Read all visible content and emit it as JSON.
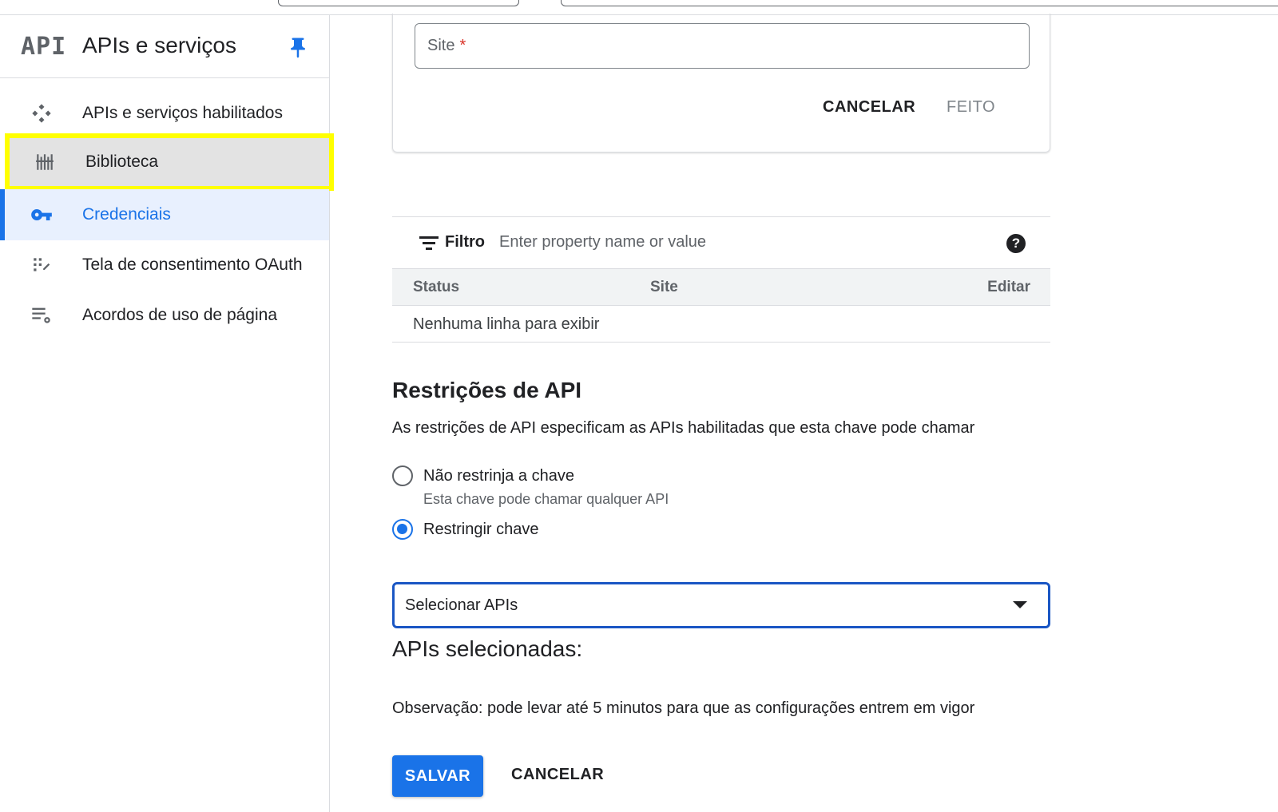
{
  "sidebar": {
    "logo_text": "API",
    "title": "APIs e serviços",
    "items": [
      {
        "label": "APIs e serviços habilitados",
        "icon": "dashboard-icon"
      },
      {
        "label": "Biblioteca",
        "icon": "library-icon"
      },
      {
        "label": "Credenciais",
        "icon": "key-icon"
      },
      {
        "label": "Tela de consentimento OAuth",
        "icon": "consent-icon"
      },
      {
        "label": "Acordos de uso de página",
        "icon": "settings-list-icon"
      }
    ]
  },
  "site_card": {
    "input_placeholder": "Site",
    "required_mark": "*",
    "cancel_label": "CANCELAR",
    "done_label": "FEITO"
  },
  "filter": {
    "label": "Filtro",
    "placeholder": "Enter property name or value",
    "help": "?"
  },
  "table": {
    "columns": [
      "Status",
      "Site",
      "Editar"
    ],
    "empty_text": "Nenhuma linha para exibir"
  },
  "api_restrictions": {
    "title": "Restrições de API",
    "description": "As restrições de API especificam as APIs habilitadas que esta chave pode chamar",
    "options": [
      {
        "label": "Não restrinja a chave",
        "sublabel": "Esta chave pode chamar qualquer API",
        "checked": false
      },
      {
        "label": "Restringir chave",
        "checked": true
      }
    ],
    "select_value": "Selecionar APIs"
  },
  "selected_apis": {
    "title": "APIs selecionadas:",
    "note": "Observação: pode levar até 5 minutos para que as configurações entrem em vigor"
  },
  "actions": {
    "save_label": "SALVAR",
    "cancel_label": "CANCELAR"
  },
  "colors": {
    "accent": "#1a73e8",
    "highlight": "#ffff00"
  }
}
